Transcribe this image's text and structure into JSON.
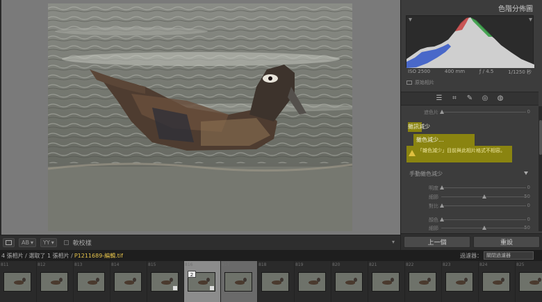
{
  "viewer": {
    "soft_proof_label": "軟校樣",
    "view_mode_labels": [
      "AB",
      "YY"
    ]
  },
  "right_panel": {
    "histogram_title": "色階分佈圖",
    "exif": {
      "iso": "ISO 2500",
      "focal": "400 mm",
      "aperture": "ƒ / 4.5",
      "shutter": "1/1250 秒"
    },
    "original_photo_label": "原始相片",
    "detail": {
      "top_slider": {
        "label": "遮色片",
        "value": "0"
      },
      "noise_reduction_header": "雜訊減少",
      "nr_button_label": "雜色減少...",
      "warning_text": "「雜色減少」目前與此相片格式不相容。",
      "manual_nr_label": "手動雜色減少",
      "sliders": [
        {
          "label": "明度",
          "value": "0",
          "fraction": 0.0
        },
        {
          "label": "細節",
          "value": "50",
          "fraction": 0.5
        },
        {
          "label": "對比",
          "value": "0",
          "fraction": 0.0
        },
        {
          "label": "顏色",
          "value": "0",
          "fraction": 0.0
        },
        {
          "label": "細節",
          "value": "50",
          "fraction": 0.5
        }
      ]
    },
    "prev_button": "上一個",
    "reset_button": "重設"
  },
  "info_bar": {
    "prefix": "4 張相片 / 選取了 1 張相片 /",
    "filename": "P1211689-編輯.tif",
    "filter_label": "過濾器：",
    "filter_value": "關閉過濾器"
  },
  "filmstrip": {
    "numbers": [
      "811",
      "812",
      "813",
      "814",
      "815",
      "816",
      "817",
      "818",
      "819",
      "820",
      "821",
      "822",
      "823",
      "824",
      "825"
    ],
    "active_index": 5,
    "selected_index": 6,
    "stack_count": "2"
  },
  "colors": {
    "highlight": "#8a8410",
    "filename": "#e6c34a"
  }
}
